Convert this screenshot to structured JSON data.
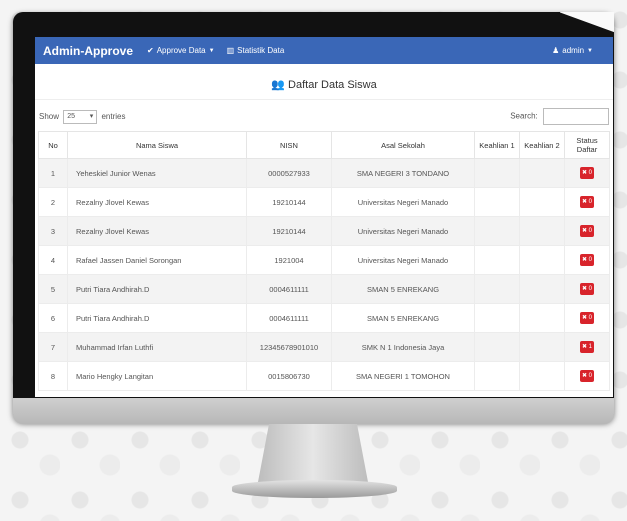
{
  "navbar": {
    "brand": "Admin-Approve",
    "menu": [
      {
        "label": "Approve Data",
        "icon": "check-icon"
      },
      {
        "label": "Statistik Data",
        "icon": "bar-chart-icon"
      }
    ],
    "user": {
      "label": "admin",
      "icon": "user-icon"
    }
  },
  "panel": {
    "title": "Daftar Data Siswa",
    "icon": "users-icon"
  },
  "controls": {
    "show_label": "Show",
    "length_value": "25",
    "entries_label": "entries",
    "search_label": "Search:"
  },
  "table": {
    "headers": [
      "No",
      "Nama Siswa",
      "NISN",
      "Asal Sekolah",
      "Keahlian 1",
      "Keahlian 2",
      "Status Daftar"
    ],
    "rows": [
      {
        "no": "1",
        "nama": "Yeheskiel Junior Wenas",
        "nisn": "0000527933",
        "sekolah": "SMA NEGERI 3 TONDANO",
        "k1": "",
        "k2": "",
        "status": "✖ 0"
      },
      {
        "no": "2",
        "nama": "Rezalny Jlovel Kewas",
        "nisn": "19210144",
        "sekolah": "Universitas Negeri Manado",
        "k1": "",
        "k2": "",
        "status": "✖ 0"
      },
      {
        "no": "3",
        "nama": "Rezalny Jlovel Kewas",
        "nisn": "19210144",
        "sekolah": "Universitas Negeri Manado",
        "k1": "",
        "k2": "",
        "status": "✖ 0"
      },
      {
        "no": "4",
        "nama": "Rafael Jassen Daniel Sorongan",
        "nisn": "1921004",
        "sekolah": "Universitas Negeri Manado",
        "k1": "",
        "k2": "",
        "status": "✖ 0"
      },
      {
        "no": "5",
        "nama": "Putri Tiara Andhirah.D",
        "nisn": "0004611111",
        "sekolah": "SMAN 5 ENREKANG",
        "k1": "",
        "k2": "",
        "status": "✖ 0"
      },
      {
        "no": "6",
        "nama": "Putri Tiara Andhirah.D",
        "nisn": "0004611111",
        "sekolah": "SMAN 5 ENREKANG",
        "k1": "",
        "k2": "",
        "status": "✖ 0"
      },
      {
        "no": "7",
        "nama": "Muhammad Irfan Luthfi",
        "nisn": "12345678901010",
        "sekolah": "SMK N 1 Indonesia Jaya",
        "k1": "",
        "k2": "",
        "status": "✖ 1"
      },
      {
        "no": "8",
        "nama": "Mario Hengky Langitan",
        "nisn": "0015806730",
        "sekolah": "SMA NEGERI 1 TOMOHON",
        "k1": "",
        "k2": "",
        "status": "✖ 0"
      }
    ]
  }
}
